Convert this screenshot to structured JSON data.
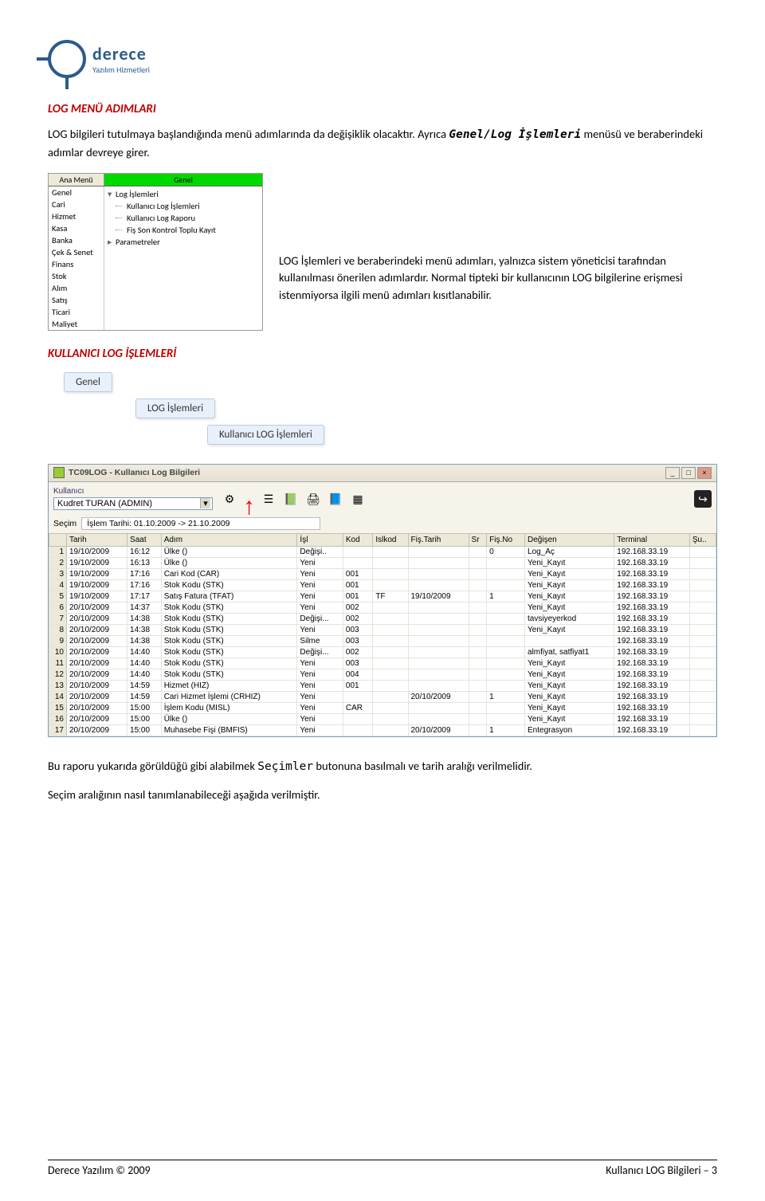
{
  "logo": {
    "main": "derece",
    "sub": "Yazılım Hizmetleri"
  },
  "section1": {
    "heading": "LOG MENÜ ADIMLARI",
    "intro_a": "LOG bilgileri tutulmaya başlandığında menü adımlarında da değişiklik olacaktır. Ayrıca ",
    "intro_b": "Genel/Log İşlemleri",
    "intro_c": " menüsü ve beraberindeki adımlar devreye girer.",
    "side_text": "LOG İşlemleri ve beraberindeki menü adımları, yalnızca sistem yöneticisi tarafından kullanılması önerilen adımlardır. Normal tipteki bir kullanıcının LOG bilgilerine erişmesi istenmiyorsa ilgili menü adımları kısıtlanabilir."
  },
  "menu_ss": {
    "top_left": "Ana Menü",
    "top_mid": "Genel",
    "sidebar": [
      "Genel",
      "Cari",
      "Hizmet",
      "Kasa",
      "Banka",
      "Çek & Senet",
      "Finans",
      "Stok",
      "Alım",
      "Satış",
      "Ticari",
      "Maliyet"
    ],
    "tree_root": "Log İşlemleri",
    "tree_children": [
      "Kullanıcı Log İşlemleri",
      "Kullanıcı Log Raporu",
      "Fiş Son Kontrol Toplu Kayıt"
    ],
    "tree_root2": "Parametreler"
  },
  "section2": {
    "heading": "KULLANICI LOG İŞLEMLERİ",
    "crumb1": "Genel",
    "crumb2": "LOG İşlemleri",
    "crumb3": "Kullanıcı LOG İşlemleri"
  },
  "window": {
    "title": "TC09LOG  -  Kullanıcı Log Bilgileri",
    "user_label": "Kullanıcı",
    "user_value": "Kudret TURAN (ADMIN)",
    "secim_label": "Seçim",
    "secim_value": "İşlem Tarihi: 01.10.2009 -> 21.10.2009",
    "cols": [
      "",
      "Tarih",
      "Saat",
      "Adım",
      "İşl",
      "Kod",
      "Islkod",
      "Fiş.Tarih",
      "Sr",
      "Fiş.No",
      "Değişen",
      "Terminal",
      "Şu.."
    ],
    "rows": [
      [
        "1",
        "19/10/2009",
        "16:12",
        "Ülke ()",
        "Değişi..",
        "",
        "",
        "",
        "",
        "0",
        "Log_Aç",
        "192.168.33.19",
        ""
      ],
      [
        "2",
        "19/10/2009",
        "16:13",
        "Ülke ()",
        "Yeni",
        "",
        "",
        "",
        "",
        "",
        "Yeni_Kayıt",
        "192.168.33.19",
        ""
      ],
      [
        "3",
        "19/10/2009",
        "17:16",
        "Cari Kod (CAR)",
        "Yeni",
        "001",
        "",
        "",
        "",
        "",
        "Yeni_Kayıt",
        "192.168.33.19",
        ""
      ],
      [
        "4",
        "19/10/2009",
        "17:16",
        "Stok Kodu (STK)",
        "Yeni",
        "001",
        "",
        "",
        "",
        "",
        "Yeni_Kayıt",
        "192.168.33.19",
        ""
      ],
      [
        "5",
        "19/10/2009",
        "17:17",
        "Satış Fatura (TFAT)",
        "Yeni",
        "001",
        "TF",
        "19/10/2009",
        "",
        "1",
        "Yeni_Kayıt",
        "192.168.33.19",
        ""
      ],
      [
        "6",
        "20/10/2009",
        "14:37",
        "Stok Kodu (STK)",
        "Yeni",
        "002",
        "",
        "",
        "",
        "",
        "Yeni_Kayıt",
        "192.168.33.19",
        ""
      ],
      [
        "7",
        "20/10/2009",
        "14:38",
        "Stok Kodu (STK)",
        "Değişi...",
        "002",
        "",
        "",
        "",
        "",
        "tavsiyeyerkod",
        "192.168.33.19",
        ""
      ],
      [
        "8",
        "20/10/2009",
        "14:38",
        "Stok Kodu (STK)",
        "Yeni",
        "003",
        "",
        "",
        "",
        "",
        "Yeni_Kayıt",
        "192.168.33.19",
        ""
      ],
      [
        "9",
        "20/10/2009",
        "14:38",
        "Stok Kodu (STK)",
        "Silme",
        "003",
        "",
        "",
        "",
        "",
        "",
        "192.168.33.19",
        ""
      ],
      [
        "10",
        "20/10/2009",
        "14:40",
        "Stok Kodu (STK)",
        "Değişi...",
        "002",
        "",
        "",
        "",
        "",
        "almfiyat, satfiyat1",
        "192.168.33.19",
        ""
      ],
      [
        "11",
        "20/10/2009",
        "14:40",
        "Stok Kodu (STK)",
        "Yeni",
        "003",
        "",
        "",
        "",
        "",
        "Yeni_Kayıt",
        "192.168.33.19",
        ""
      ],
      [
        "12",
        "20/10/2009",
        "14:40",
        "Stok Kodu (STK)",
        "Yeni",
        "004",
        "",
        "",
        "",
        "",
        "Yeni_Kayıt",
        "192.168.33.19",
        ""
      ],
      [
        "13",
        "20/10/2009",
        "14:59",
        "Hizmet (HIZ)",
        "Yeni",
        "001",
        "",
        "",
        "",
        "",
        "Yeni_Kayıt",
        "192.168.33.19",
        ""
      ],
      [
        "14",
        "20/10/2009",
        "14:59",
        "Cari Hizmet İşlemi (CRHIZ)",
        "Yeni",
        "",
        "",
        "20/10/2009",
        "",
        "1",
        "Yeni_Kayıt",
        "192.168.33.19",
        ""
      ],
      [
        "15",
        "20/10/2009",
        "15:00",
        "İşlem Kodu (MISL)",
        "Yeni",
        "CAR",
        "",
        "",
        "",
        "",
        "Yeni_Kayıt",
        "192.168.33.19",
        ""
      ],
      [
        "16",
        "20/10/2009",
        "15:00",
        "Ülke ()",
        "Yeni",
        "",
        "",
        "",
        "",
        "",
        "Yeni_Kayıt",
        "192.168.33.19",
        ""
      ],
      [
        "17",
        "20/10/2009",
        "15:00",
        "Muhasebe Fişi (BMFIS)",
        "Yeni",
        "",
        "",
        "20/10/2009",
        "",
        "1",
        "Entegrasyon",
        "192.168.33.19",
        ""
      ]
    ]
  },
  "closing": {
    "p1a": "Bu raporu yukarıda görüldüğü gibi alabilmek ",
    "p1b": "Seçimler",
    "p1c": " butonuna basılmalı ve tarih aralığı verilmelidir.",
    "p2": "Seçim aralığının nasıl tanımlanabileceği aşağıda verilmiştir."
  },
  "footer": {
    "left": "Derece Yazılım © 2009",
    "right": "Kullanıcı LOG Bilgileri – 3"
  }
}
